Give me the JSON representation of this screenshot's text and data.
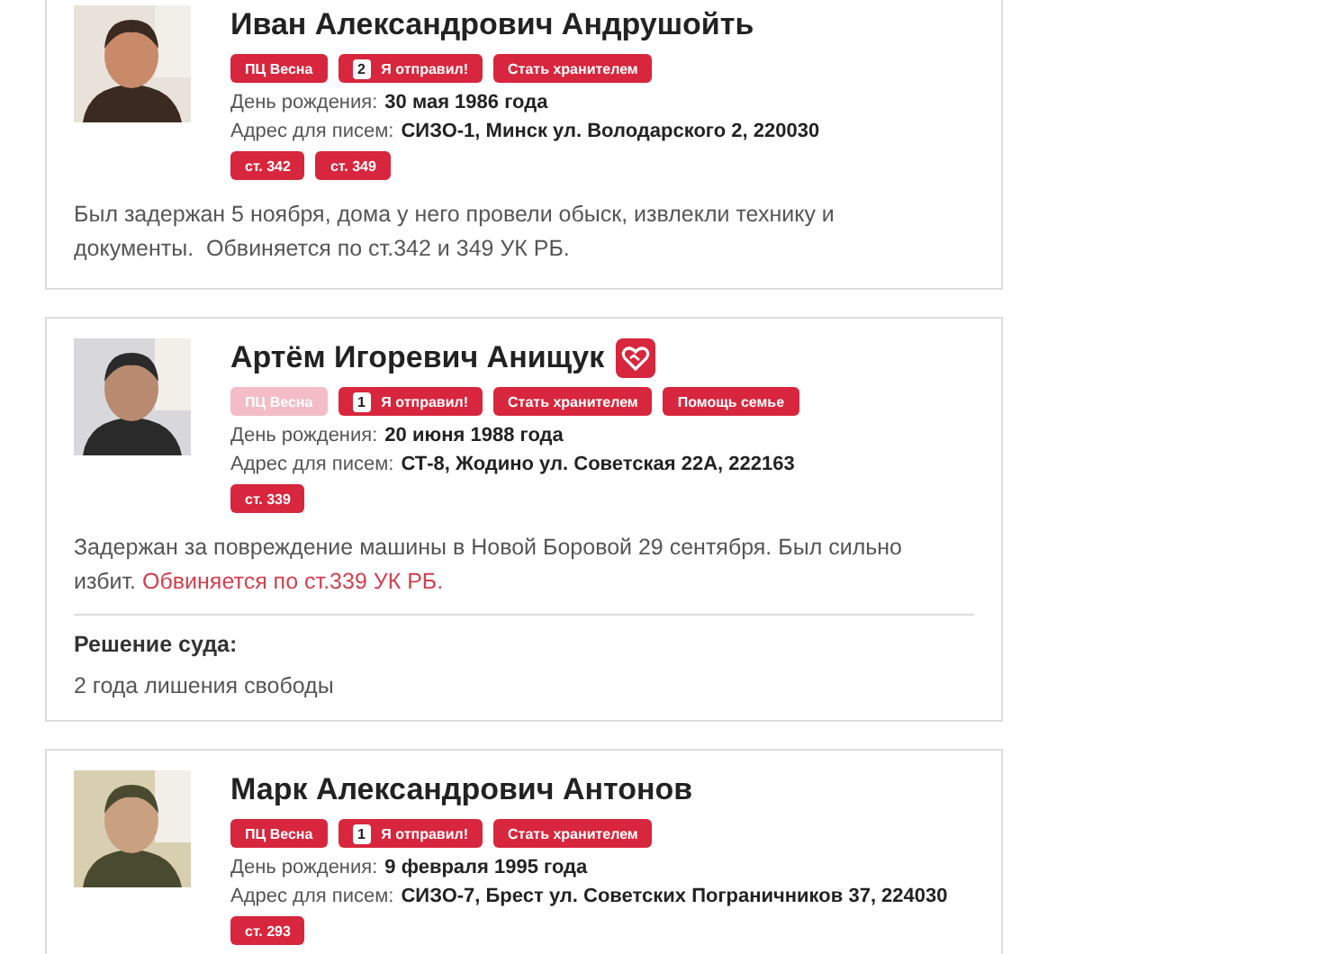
{
  "prisoners": [
    {
      "name": "Иван Александрович Андрушойть",
      "family_help_icon": false,
      "actions": [
        {
          "kind": "plain",
          "label": "ПЦ Весна",
          "disabled": false
        },
        {
          "kind": "counter",
          "count": "2",
          "label": "Я отправил!",
          "disabled": false
        },
        {
          "kind": "plain",
          "label": "Стать хранителем",
          "disabled": false
        }
      ],
      "birthday": {
        "label": "День рождения:",
        "value": "30 мая 1986 года"
      },
      "address": {
        "label": "Адрес для писем:",
        "value": "СИЗО-1, Минск ул. Володарского 2, 220030"
      },
      "articles": [
        "ст. 342",
        "ст. 349"
      ],
      "description": [
        {
          "text": "Был задержан 5 ноября, дома у него провели обыск, извлекли технику и документы.  Обвиняется по ст.342 и 349 УК РБ.",
          "highlight": false
        }
      ]
    },
    {
      "name": "Артём Игоревич Анищук",
      "family_help_icon": true,
      "actions": [
        {
          "kind": "plain",
          "label": "ПЦ Весна",
          "disabled": true
        },
        {
          "kind": "counter",
          "count": "1",
          "label": "Я отправил!",
          "disabled": false
        },
        {
          "kind": "plain",
          "label": "Стать хранителем",
          "disabled": false
        },
        {
          "kind": "plain",
          "label": "Помощь семье",
          "disabled": false
        }
      ],
      "birthday": {
        "label": "День рождения:",
        "value": "20 июня 1988 года"
      },
      "address": {
        "label": "Адрес для писем:",
        "value": "СТ-8, Жодино ул. Советская 22А, 222163"
      },
      "articles": [
        "ст. 339"
      ],
      "description": [
        {
          "text": "Задержан за повреждение машины в Новой Боровой 29 сентября. Был сильно избит. ",
          "highlight": false
        },
        {
          "text": "Обвиняется по ст.339 УК РБ.",
          "highlight": true
        }
      ],
      "verdict": {
        "title": "Решение суда:",
        "text": "2 года лишения свободы"
      }
    },
    {
      "name": "Марк Александрович Антонов",
      "family_help_icon": false,
      "actions": [
        {
          "kind": "plain",
          "label": "ПЦ Весна",
          "disabled": false
        },
        {
          "kind": "counter",
          "count": "1",
          "label": "Я отправил!",
          "disabled": false
        },
        {
          "kind": "plain",
          "label": "Стать хранителем",
          "disabled": false
        }
      ],
      "birthday": {
        "label": "День рождения:",
        "value": "9 февраля 1995 года"
      },
      "address": {
        "label": "Адрес для писем:",
        "value": "СИЗО-7, Брест ул. Советских Пограничников 37, 224030"
      },
      "articles": [
        "ст. 293"
      ]
    }
  ]
}
